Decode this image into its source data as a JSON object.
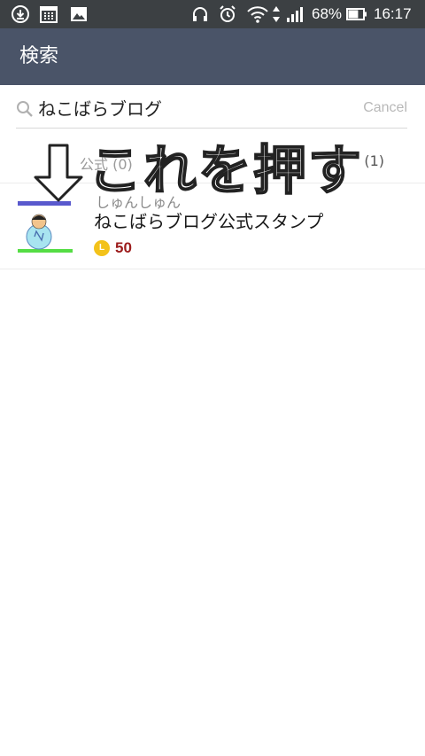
{
  "status_bar": {
    "battery_percent": "68%",
    "time": "16:17",
    "battery_level": 0.68,
    "icons": [
      "download-icon",
      "calendar-icon",
      "image-icon",
      "headphones-icon",
      "alarm-icon",
      "wifi-icon",
      "data-arrows-icon",
      "signal-icon",
      "battery-icon"
    ]
  },
  "app_bar": {
    "title": "検索"
  },
  "search": {
    "query": "ねこばらブログ",
    "cancel_label": "Cancel",
    "icon": "search-icon"
  },
  "section": {
    "label": "公式 (0)",
    "count": "(1)"
  },
  "overlay": {
    "text": "これを押す",
    "arrow": "down-arrow-icon"
  },
  "result": {
    "author": "しゅんしゅん",
    "title": "ねこばらブログ公式スタンプ",
    "coin_letter": "L",
    "price": "50"
  },
  "colors": {
    "status_bar": "#3c4043",
    "app_bar": "#4a5468",
    "price": "#9c1c1c",
    "coin": "#f3c21a"
  }
}
